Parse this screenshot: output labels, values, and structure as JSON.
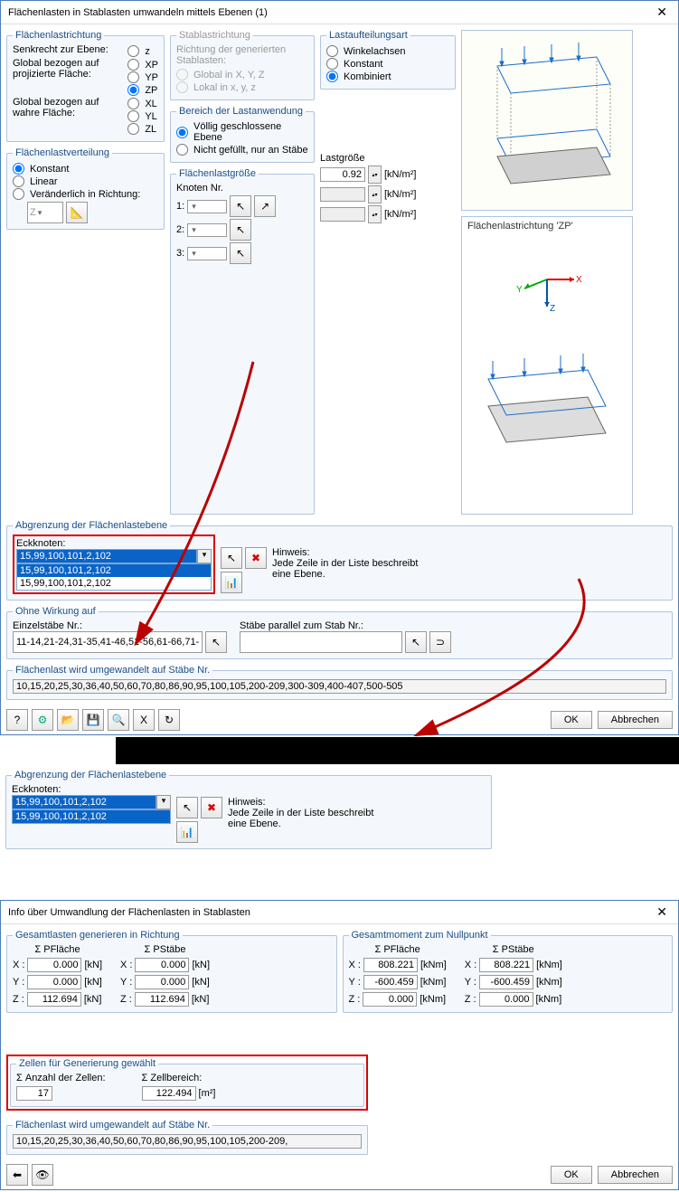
{
  "dialog1": {
    "title": "Flächenlasten in Stablasten umwandeln mittels Ebenen   (1)",
    "close": "✕",
    "flachenlastrichtung": {
      "legend": "Flächenlastrichtung",
      "opt1_label": "Senkrecht zur Ebene:",
      "opt1_radio": "z",
      "opt2_label": "Global bezogen auf projizierte Fläche:",
      "opt2_radios": [
        "XP",
        "YP",
        "ZP"
      ],
      "opt3_label": "Global bezogen auf wahre Fläche:",
      "opt3_radios": [
        "XL",
        "YL",
        "ZL"
      ]
    },
    "stablastrichtung": {
      "legend": "Stablastrichtung",
      "desc": "Richtung der generierten Stablasten:",
      "radios": [
        "Global in X, Y, Z",
        "Lokal in x, y, z"
      ]
    },
    "lastaufteilungsart": {
      "legend": "Lastaufteilungsart",
      "radios": [
        "Winkelachsen",
        "Konstant",
        "Kombiniert"
      ]
    },
    "bereich": {
      "legend": "Bereich der Lastanwendung",
      "radios": [
        "Völlig geschlossene Ebene",
        "Nicht gefüllt, nur an Stäbe"
      ]
    },
    "flachenlastverteilung": {
      "legend": "Flächenlastverteilung",
      "radios": [
        "Konstant",
        "Linear",
        "Veränderlich in Richtung:"
      ],
      "dir_combo": "Z"
    },
    "flachenlastgroesse": {
      "legend": "Flächenlastgröße",
      "h1": "Knoten Nr.",
      "h2": "Lastgröße",
      "rows": [
        "1:",
        "2:",
        "3:"
      ],
      "values": [
        "0.92",
        "",
        ""
      ],
      "unit": "[kN/m²]"
    },
    "abgrenzung": {
      "legend": "Abgrenzung der Flächenlastebene",
      "label": "Eckknoten:",
      "value": "15,99,100,101,2,102",
      "dd1": "15,99,100,101,2,102",
      "dd2": "15,99,100,101,2,102",
      "hinweis_label": "Hinweis:",
      "hinweis_text": "Jede Zeile in der Liste beschreibt eine Ebene."
    },
    "ohne_wirkung": {
      "legend": "Ohne Wirkung auf",
      "label1": "Einzelstäbe Nr.:",
      "val1": "11-14,21-24,31-35,41-46,51-56,61-66,71-",
      "label2": "Stäbe parallel zum Stab Nr.:",
      "val2": ""
    },
    "umgewandelt": {
      "legend": "Flächenlast wird umgewandelt auf Stäbe Nr.",
      "val": "10,15,20,25,30,36,40,50,60,70,80,86,90,95,100,105,200-209,300-309,400-407,500-505"
    },
    "preview_label": "Flächenlastrichtung 'ZP'",
    "axes": {
      "x": "X",
      "y": "Y",
      "z": "Z"
    },
    "buttons": {
      "ok": "OK",
      "cancel": "Abbrechen"
    }
  },
  "snippet": {
    "legend": "Abgrenzung der Flächenlastebene",
    "label": "Eckknoten:",
    "value": "15,99,100,101,2,102",
    "dd_item": "15,99,100,101,2,102",
    "hinweis_label": "Hinweis:",
    "hinweis_text": "Jede Zeile in der Liste beschreibt eine Ebene."
  },
  "dialog2": {
    "title": "Info über Umwandlung der Flächenlasten in Stablasten",
    "close": "✕",
    "group1_legend": "Gesamtlasten generieren in Richtung",
    "group2_legend": "Gesamtmoment zum Nullpunkt",
    "h_flache": "Σ PFläche",
    "h_stabe": "Σ PStäbe",
    "rows_label": [
      "X :",
      "Y :",
      "Z :"
    ],
    "g1_flache": [
      "0.000",
      "0.000",
      "112.694"
    ],
    "g1_stabe": [
      "0.000",
      "0.000",
      "112.694"
    ],
    "g1_unit": "[kN]",
    "g2_flache": [
      "808.221",
      "-600.459",
      "0.000"
    ],
    "g2_stabe": [
      "808.221",
      "-600.459",
      "0.000"
    ],
    "g2_unit": "[kNm]",
    "zellen": {
      "legend": "Zellen für Generierung gewählt",
      "l1": "Σ Anzahl der Zellen:",
      "v1": "17",
      "l2": "Σ Zellbereich:",
      "v2": "122.494",
      "unit": "[m²]"
    },
    "umgewandelt": {
      "legend": "Flächenlast wird umgewandelt auf Stäbe Nr.",
      "val": "10,15,20,25,30,36,40,50,60,70,80,86,90,95,100,105,200-209,"
    },
    "buttons": {
      "ok": "OK",
      "cancel": "Abbrechen"
    }
  }
}
